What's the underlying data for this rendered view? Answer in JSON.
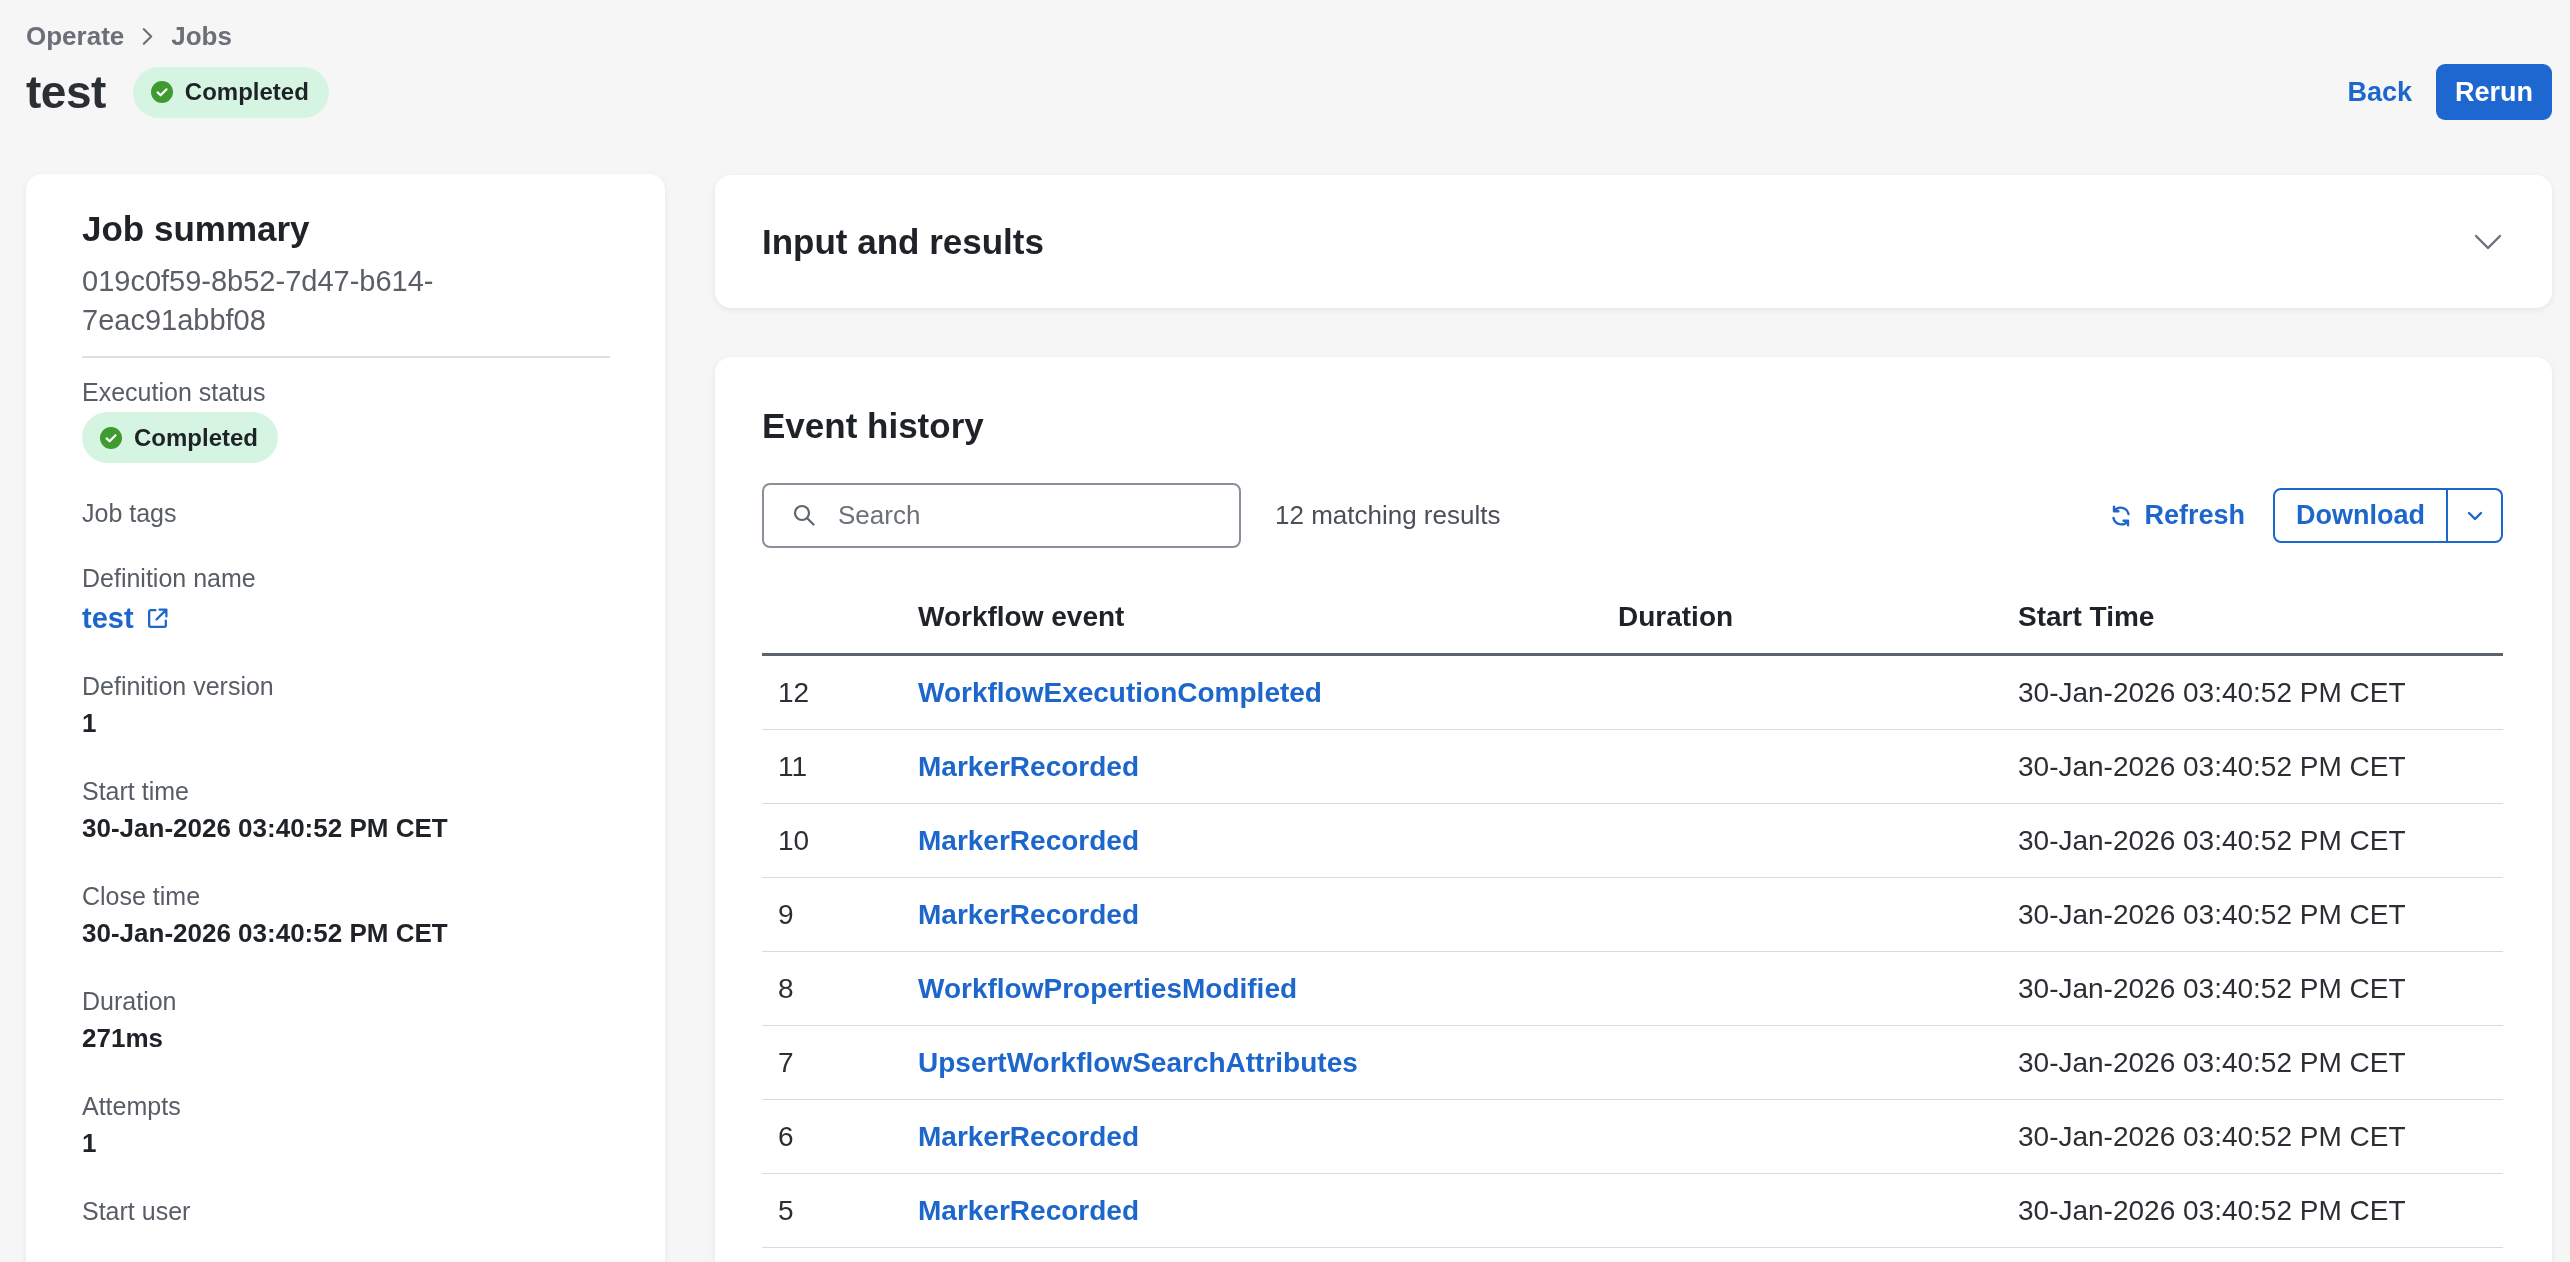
{
  "breadcrumb": [
    {
      "label": "Operate"
    },
    {
      "label": "Jobs"
    }
  ],
  "header": {
    "title": "test",
    "status": "Completed"
  },
  "actions": [
    {
      "kind": "link",
      "label": "Back"
    },
    {
      "kind": "primary",
      "label": "Rerun"
    }
  ],
  "job_summary": {
    "title": "Job summary",
    "job_id": "019c0f59-8b52-7d47-b614-7eac91abbf08",
    "fields": [
      {
        "label": "Execution status",
        "kind": "badge",
        "value": "Completed"
      },
      {
        "label": "Job tags",
        "kind": "text"
      },
      {
        "label": "Definition name",
        "kind": "link",
        "value": "test"
      },
      {
        "label": "Definition version",
        "kind": "text",
        "value": "1"
      },
      {
        "label": "Start time",
        "kind": "text",
        "value": "30-Jan-2026 03:40:52 PM CET"
      },
      {
        "label": "Close time",
        "kind": "text",
        "value": "30-Jan-2026 03:40:52 PM CET"
      },
      {
        "label": "Duration",
        "kind": "text",
        "value": "271ms"
      },
      {
        "label": "Attempts",
        "kind": "text",
        "value": "1"
      },
      {
        "label": "Start user",
        "kind": "text"
      }
    ]
  },
  "input_and_results": {
    "title": "Input and results",
    "expanded": false
  },
  "event_history": {
    "title": "Event history",
    "search": {
      "placeholder": "Search"
    },
    "result_count": "12 matching results",
    "refresh": "Refresh",
    "download": "Download",
    "table": {
      "columns": [
        "Workflow event",
        "Duration",
        "Start Time"
      ],
      "rows": [
        {
          "number": "12",
          "event": "WorkflowExecutionCompleted",
          "start_time": "30-Jan-2026 03:40:52 PM CET"
        },
        {
          "number": "11",
          "event": "MarkerRecorded",
          "start_time": "30-Jan-2026 03:40:52 PM CET"
        },
        {
          "number": "10",
          "event": "MarkerRecorded",
          "start_time": "30-Jan-2026 03:40:52 PM CET"
        },
        {
          "number": "9",
          "event": "MarkerRecorded",
          "start_time": "30-Jan-2026 03:40:52 PM CET"
        },
        {
          "number": "8",
          "event": "WorkflowPropertiesModified",
          "start_time": "30-Jan-2026 03:40:52 PM CET"
        },
        {
          "number": "7",
          "event": "UpsertWorkflowSearchAttributes",
          "start_time": "30-Jan-2026 03:40:52 PM CET"
        },
        {
          "number": "6",
          "event": "MarkerRecorded",
          "start_time": "30-Jan-2026 03:40:52 PM CET"
        },
        {
          "number": "5",
          "event": "MarkerRecorded",
          "start_time": "30-Jan-2026 03:40:52 PM CET"
        }
      ]
    }
  }
}
